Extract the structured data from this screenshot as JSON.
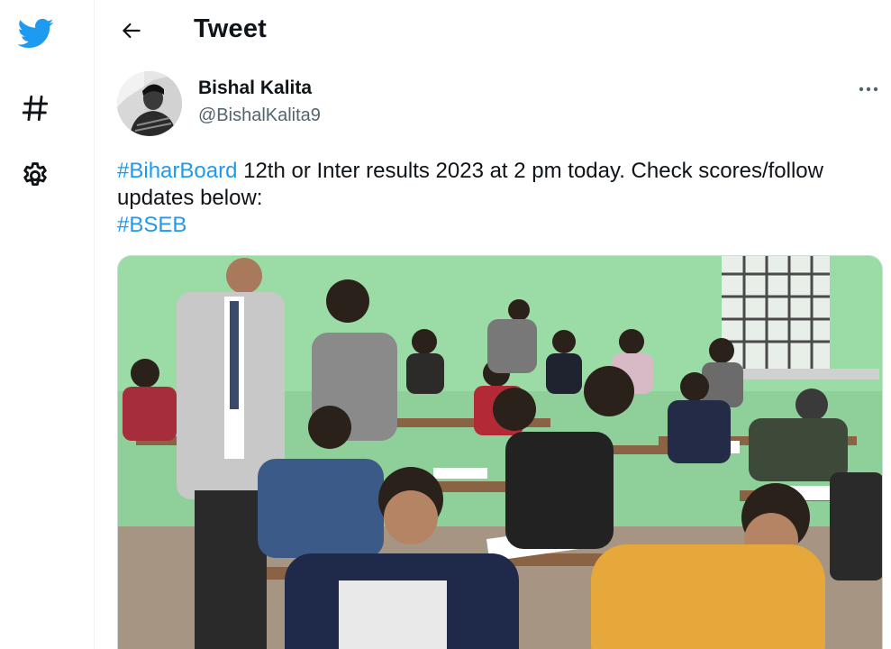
{
  "nav": {
    "logo_icon": "twitter-bird-icon",
    "explore_icon": "hashtag-icon",
    "settings_icon": "gear-icon"
  },
  "header": {
    "title": "Tweet",
    "back_icon": "arrow-left-icon"
  },
  "tweet": {
    "author_name": "Bishal Kalita",
    "author_handle": "@BishalKalita9",
    "more_icon": "ellipsis-icon",
    "hashtag1": "#BiharBoard",
    "text_part1": " 12th or Inter results 2023 at 2 pm today. Check scores/follow updates below:",
    "hashtag2": "#BSEB"
  },
  "colors": {
    "brand": "#1d9bf0",
    "text": "#0f1419",
    "secondary": "#536471"
  }
}
